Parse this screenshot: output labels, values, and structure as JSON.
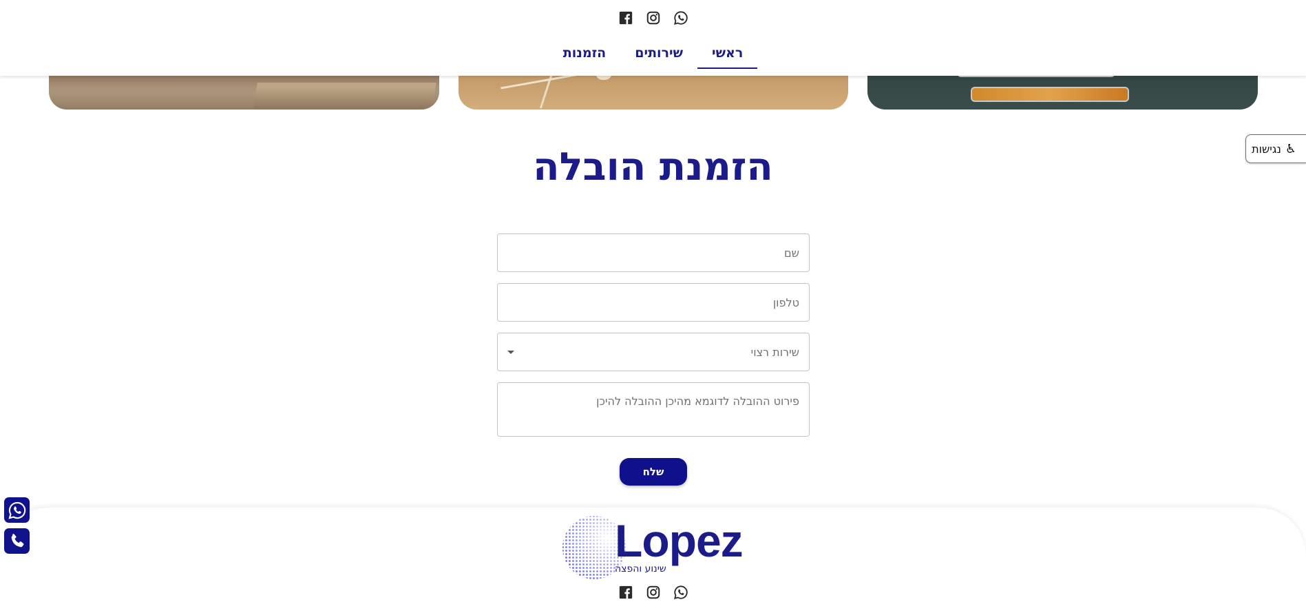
{
  "header": {
    "social": [
      {
        "icon": "facebook-icon"
      },
      {
        "icon": "instagram-icon"
      },
      {
        "icon": "whatsapp-icon"
      }
    ],
    "nav": [
      {
        "label": "ראשי",
        "active": true
      },
      {
        "label": "שירותים",
        "active": false
      },
      {
        "label": "הזמנות",
        "active": false
      }
    ]
  },
  "accessibility": {
    "label": "נגישות",
    "icon": "wheelchair-icon"
  },
  "form": {
    "title": "הזמנת הובלה",
    "name_placeholder": "שם",
    "phone_placeholder": "טלפון",
    "service_placeholder": "שירות רצוי",
    "details_placeholder": "פירוט ההובלה לדוגמא מהיכן ההובלה להיכן",
    "submit_label": "שלח"
  },
  "footer": {
    "logo_text": "Lopez",
    "logo_subtitle": "שינוע והפצה",
    "social": [
      {
        "icon": "facebook-icon"
      },
      {
        "icon": "instagram-icon"
      },
      {
        "icon": "whatsapp-icon"
      }
    ]
  },
  "floating": [
    {
      "icon": "whatsapp-icon"
    },
    {
      "icon": "phone-icon"
    }
  ],
  "colors": {
    "brand": "#1b1c8a",
    "button": "#0f108c"
  }
}
